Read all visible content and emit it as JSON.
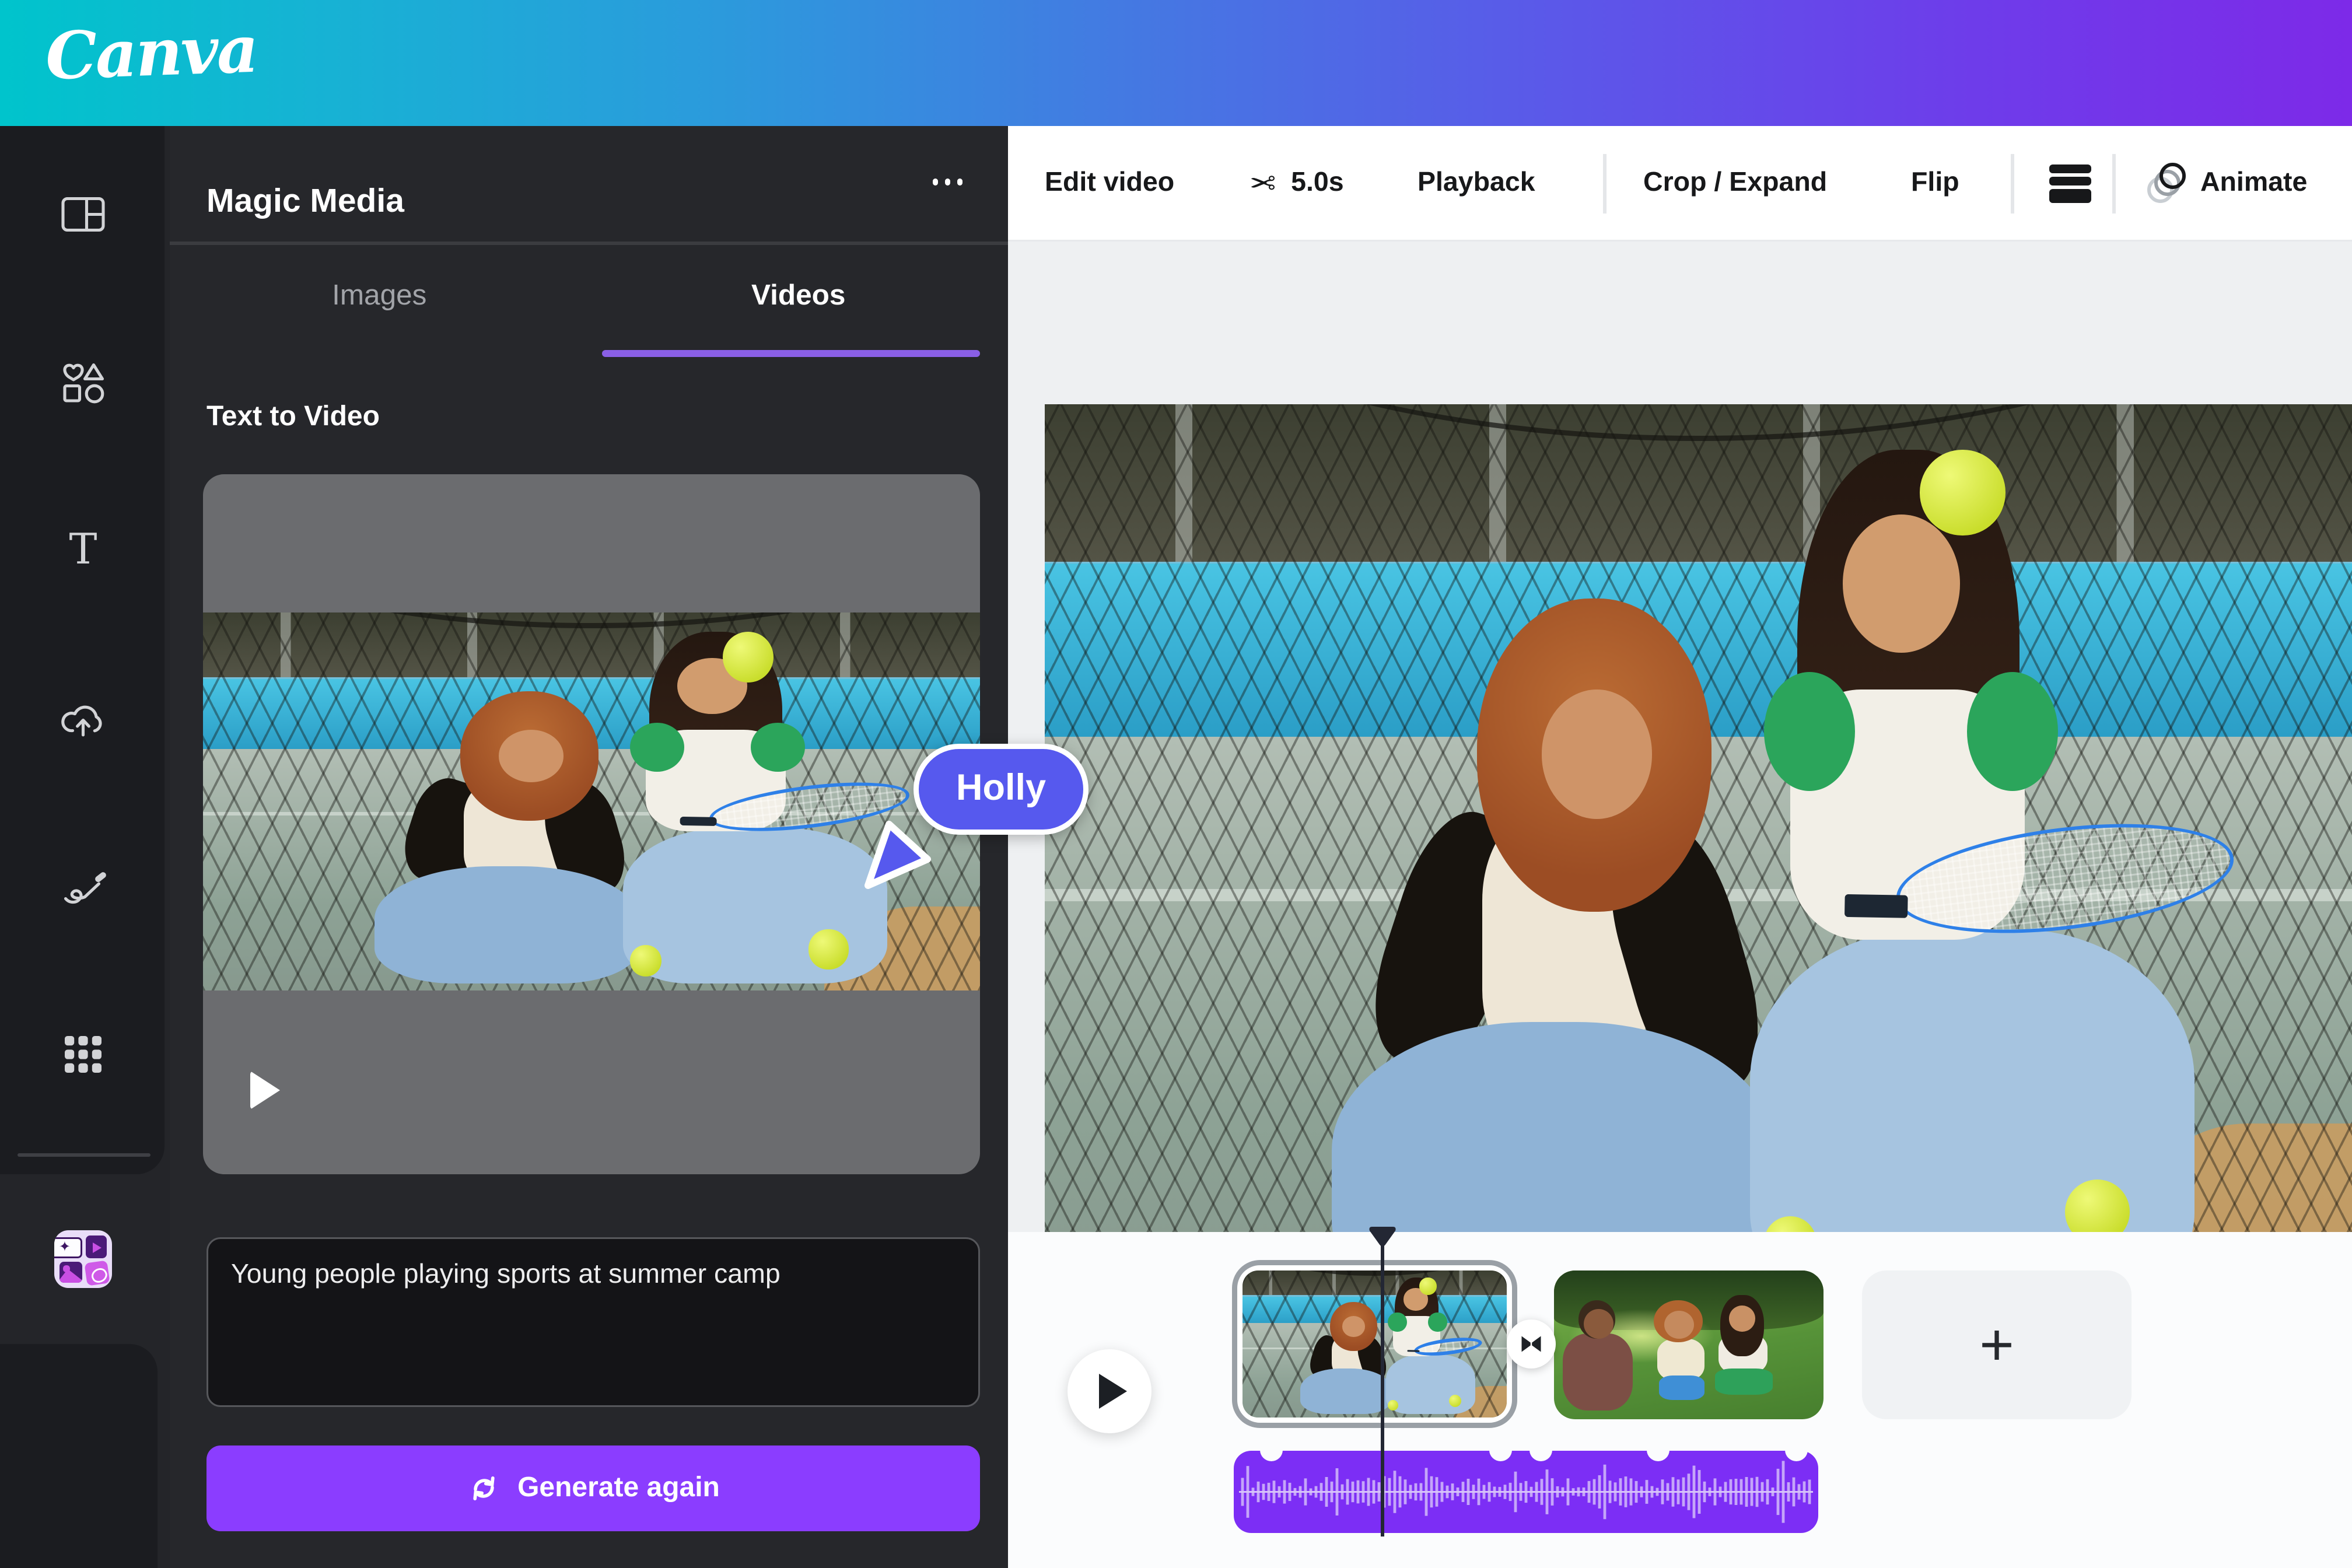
{
  "header": {
    "logo": "Canva"
  },
  "sidebar": {
    "tools": [
      {
        "id": "design",
        "icon": "layout-grid-icon"
      },
      {
        "id": "elements",
        "icon": "shapes-icon"
      },
      {
        "id": "text",
        "icon": "text-icon"
      },
      {
        "id": "uploads",
        "icon": "upload-cloud-icon"
      },
      {
        "id": "draw",
        "icon": "draw-icon"
      },
      {
        "id": "apps",
        "icon": "apps-grid-icon"
      }
    ],
    "app_shortcut": "magic-media-app-icon"
  },
  "panel": {
    "title": "Magic Media",
    "menu_icon": "ellipsis-icon",
    "tabs": {
      "images": "Images",
      "videos": "Videos",
      "active_tab": "Videos"
    },
    "section_label": "Text to Video",
    "preview_play_icon": "play-icon",
    "prompt_value": "Young people playing sports at summer camp",
    "generate_label": "Generate again",
    "generate_icon": "regenerate-icon"
  },
  "toolbar": {
    "edit_video": "Edit video",
    "trim_icon": "scissors-icon",
    "duration": "5.0s",
    "playback": "Playback",
    "crop_expand": "Crop / Expand",
    "flip": "Flip",
    "position_icon": "position-layers-icon",
    "animate_icon": "animate-motion-icon",
    "animate": "Animate"
  },
  "collaborator": {
    "name": "Holly",
    "cursor_color": "#5659EE"
  },
  "timeline": {
    "play_icon": "play-icon",
    "transition_icon": "transition-bowtie-icon",
    "add_label": "+",
    "clip_count": 2,
    "audio_color": "#7C2EF5"
  },
  "colors": {
    "brand_gradient_start": "#00C4CC",
    "brand_gradient_end": "#7D2AE8",
    "accent_purple": "#8B3DFF",
    "tab_underline": "#8A5FE6",
    "panel_bg": "#26272B",
    "rail_bg": "#1B1C20",
    "canvas_bg": "#EEF0F2",
    "timeline_bg": "#FBFCFD"
  }
}
